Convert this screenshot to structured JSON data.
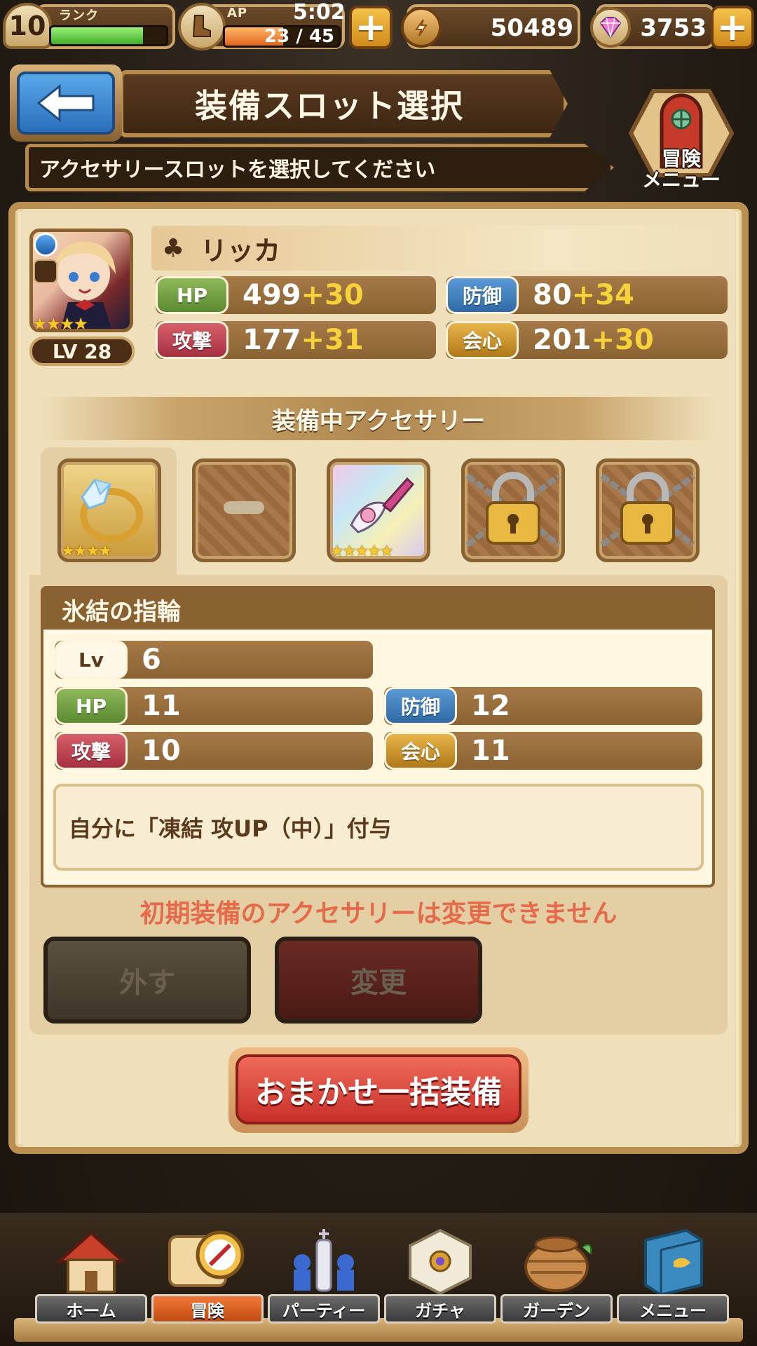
{
  "status_bar": {
    "rank_level": "10",
    "rank_label": "ランク",
    "rank_progress": 0.8,
    "ap_label": "AP",
    "ap_timer": "5:02",
    "ap_value": "23 / 45",
    "ap_progress": 0.51,
    "coins": "50489",
    "gems": "3753"
  },
  "header": {
    "title": "装備スロット選択",
    "subtitle": "アクセサリースロットを選択してください",
    "adventure_menu_label": "冒険\nメニュー"
  },
  "character": {
    "name": "リッカ",
    "level": "LV 28",
    "stars": 4,
    "stats": [
      {
        "key": "hp",
        "label": "HP",
        "base": "499",
        "bonus": "+30"
      },
      {
        "key": "def",
        "label": "防御",
        "base": "80",
        "bonus": "+34"
      },
      {
        "key": "atk",
        "label": "攻撃",
        "base": "177",
        "bonus": "+31"
      },
      {
        "key": "crit",
        "label": "会心",
        "base": "201",
        "bonus": "+30"
      }
    ]
  },
  "equipped_section": {
    "title": "装備中アクセサリー",
    "slots": [
      {
        "state": "item",
        "icon": "ice-ring-icon",
        "stars": 4
      },
      {
        "state": "empty",
        "icon": "empty-slot-icon"
      },
      {
        "state": "item",
        "icon": "ribbon-accessory-icon",
        "stars": 5
      },
      {
        "state": "locked",
        "icon": "padlock-icon"
      },
      {
        "state": "locked",
        "icon": "padlock-icon"
      }
    ]
  },
  "detail": {
    "name": "氷結の指輪",
    "lv_label": "Lv",
    "lv": "6",
    "hp_label": "HP",
    "hp": "11",
    "def_label": "防御",
    "def": "12",
    "atk_label": "攻撃",
    "atk": "10",
    "crit_label": "会心",
    "crit": "11",
    "description": "自分に「凍結 攻UP（中）」付与"
  },
  "warning": "初期装備のアクセサリーは変更できません",
  "buttons": {
    "remove": "外す",
    "change": "変更",
    "auto_equip": "おまかせ一括装備"
  },
  "nav": [
    {
      "label": "ホーム",
      "icon": "house-icon"
    },
    {
      "label": "冒険",
      "icon": "compass-map-icon"
    },
    {
      "label": "パーティー",
      "icon": "chess-pieces-icon"
    },
    {
      "label": "ガチャ",
      "icon": "gacha-cube-icon"
    },
    {
      "label": "ガーデン",
      "icon": "basket-icon"
    },
    {
      "label": "メニュー",
      "icon": "book-icon"
    }
  ],
  "colors": {
    "hp_tag": "#6f9e44",
    "def_tag": "#3f7ebe",
    "atk_tag": "#bc4450",
    "crit_tag": "#cc9630",
    "bonus": "#f7d23a",
    "warning": "#e46a4a"
  }
}
